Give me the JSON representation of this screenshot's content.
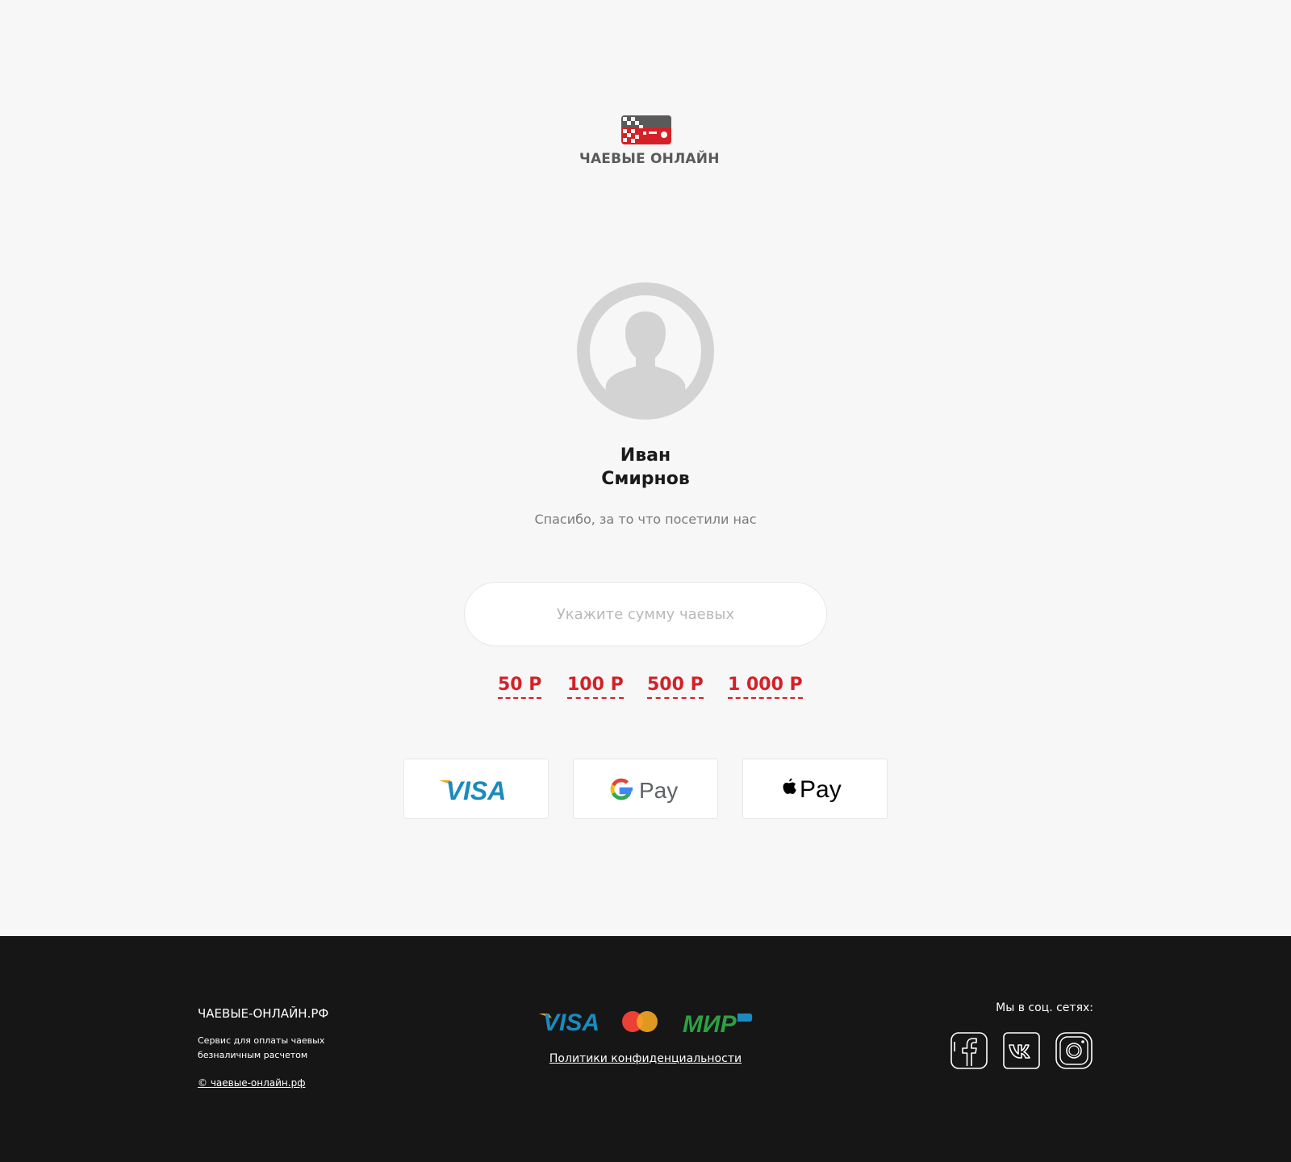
{
  "brand": {
    "logo_text": "ЧАЕВЫЕ ОНЛАЙН",
    "colors": {
      "accent": "#d52028",
      "logo_gray": "#5a5a5a",
      "footer_bg": "#161616",
      "page_bg": "#f7f7f7"
    }
  },
  "profile": {
    "first_name": "Иван",
    "last_name": "Смирнов",
    "thanks_text": "Спасибо, за то что посетили нас",
    "avatar_icon": "person-silhouette-icon"
  },
  "tip": {
    "amount_value": "",
    "placeholder": "Укажите сумму чаевых",
    "presets": [
      "50 Р",
      "100 Р",
      "500 Р",
      "1 000 Р"
    ]
  },
  "payment_methods": [
    {
      "name": "visa",
      "icon": "visa-icon"
    },
    {
      "name": "google-pay",
      "icon": "google-pay-icon"
    },
    {
      "name": "apple-pay",
      "icon": "apple-pay-icon"
    }
  ],
  "footer": {
    "site_name": "ЧАЕВЫЕ-ОНЛАЙН.РФ",
    "description": "Сервис для оплаты чаевых безналичным расчетом",
    "copyright": "© чаевые-онлайн.рф",
    "accepted_cards": [
      "visa-icon",
      "mastercard-icon",
      "mir-icon"
    ],
    "privacy_link": "Политики конфиденциальности",
    "social_label": "Мы в соц. сетях:",
    "social": [
      "facebook-icon",
      "vk-icon",
      "instagram-icon"
    ]
  }
}
